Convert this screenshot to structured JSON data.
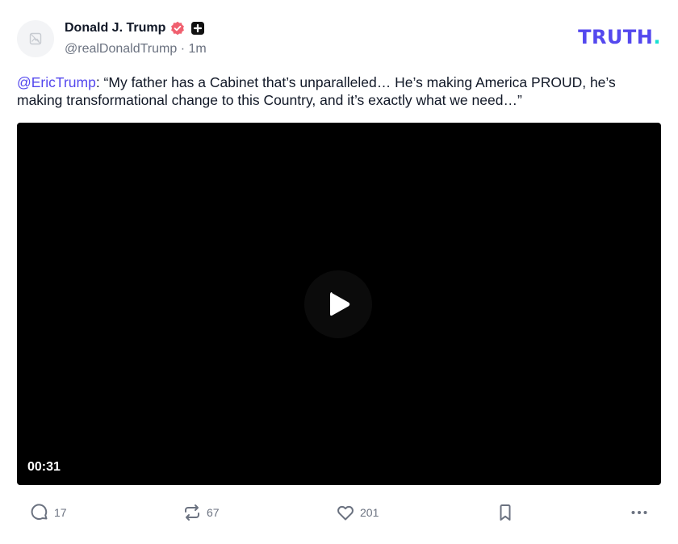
{
  "author": {
    "name": "Donald J. Trump",
    "handle": "@realDonaldTrump",
    "meta_separator": "·",
    "time_ago": "1m"
  },
  "brand": {
    "logo_text": "TRUTH",
    "logo_dot": ".",
    "primary_color": "#5448ee",
    "accent_color": "#17e0d2"
  },
  "post": {
    "mention": "@EricTrump",
    "text": ": “My father has a Cabinet that’s unparalleled… He’s making America PROUD, he’s making transformational change to this Country, and it’s exactly what we need…”"
  },
  "video": {
    "duration": "00:31",
    "play_icon": "play-icon"
  },
  "actions": {
    "replies": "17",
    "reposts": "67",
    "likes": "201",
    "icons": [
      "comment-icon",
      "repost-icon",
      "heart-icon",
      "bookmark-icon",
      "more-icon"
    ]
  }
}
